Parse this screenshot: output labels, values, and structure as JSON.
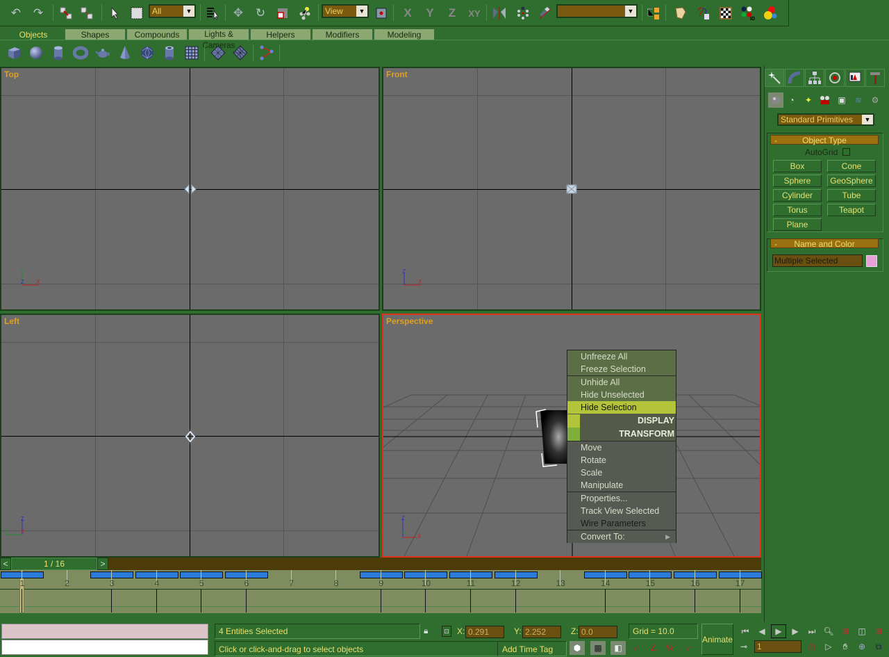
{
  "toolbar": {
    "selection_filter": "All",
    "reference_coord": "View",
    "named_selection": "",
    "constraint_labels": [
      "X",
      "Y",
      "Z",
      "XY"
    ]
  },
  "tabs": [
    {
      "label": "Objects",
      "active": true
    },
    {
      "label": "Shapes"
    },
    {
      "label": "Compounds"
    },
    {
      "label": "Lights & Cameras"
    },
    {
      "label": "Helpers"
    },
    {
      "label": "Modifiers"
    },
    {
      "label": "Modeling"
    }
  ],
  "object_icons": [
    "box-icon",
    "sphere-icon",
    "cylinder-icon",
    "torus-icon",
    "teapot-icon",
    "cone-icon",
    "geosphere-icon",
    "tube-icon",
    "plane-icon",
    "patch-quad-icon",
    "patch-tri-icon",
    "bone-icon"
  ],
  "viewports": {
    "top": {
      "label": "Top",
      "axes": [
        "Y",
        "Z",
        "X"
      ]
    },
    "front": {
      "label": "Front",
      "axes": [
        "Z",
        "X"
      ]
    },
    "left": {
      "label": "Left",
      "axes": [
        "Z",
        "Y",
        "X"
      ]
    },
    "perspective": {
      "label": "Perspective",
      "axes": [
        "Z",
        "Y",
        "X"
      ],
      "active": true
    }
  },
  "quad_menu": {
    "upper": [
      "Unfreeze All",
      "Freeze Selection",
      "Unhide All",
      "Hide Unselected",
      "Hide Selection"
    ],
    "highlighted": "Hide Selection",
    "display_title": "DISPLAY",
    "transform_title": "TRANSFORM",
    "lower": [
      "Move",
      "Rotate",
      "Scale",
      "Manipulate",
      "Properties...",
      "Track View Selected",
      "Wire Parameters",
      "Convert To:"
    ]
  },
  "command_panel": {
    "category": "Standard Primitives",
    "object_type_title": "Object Type",
    "autogrid_label": "AutoGrid",
    "autogrid_checked": false,
    "buttons": [
      "Box",
      "Cone",
      "Sphere",
      "GeoSphere",
      "Cylinder",
      "Tube",
      "Torus",
      "Teapot",
      "Plane"
    ],
    "name_color_title": "Name and Color",
    "name_value": "Multiple Selected",
    "object_color": "#e8a0d8",
    "rollout_collapse": "-"
  },
  "time_slider": {
    "label": "1 / 16",
    "prev": "<",
    "next": ">",
    "current_frame": 1,
    "total_frames": 16
  },
  "track_bar": {
    "ticks": [
      "1",
      "2",
      "3",
      "4",
      "5",
      "6",
      "7",
      "8",
      "9",
      "10",
      "11",
      "12",
      "13",
      "14",
      "15",
      "16",
      "17"
    ],
    "keyed_frames": [
      1,
      3,
      4,
      5,
      6,
      9,
      10,
      11,
      12,
      14,
      15,
      16,
      17
    ]
  },
  "status": {
    "selection": "4 Entities Selected",
    "prompt": "Click or click-and-drag to select objects",
    "x_label": "X:",
    "x_value": "0.291",
    "y_label": "Y:",
    "y_value": "2.252",
    "z_label": "Z:",
    "z_value": "0.0",
    "grid": "Grid = 10.0",
    "add_time_tag": "Add Time Tag",
    "animate": "Animate",
    "frame_value": "1"
  },
  "colors": {
    "ui_bg": "#2f6e2f",
    "viewport_bg": "#6b6b6b",
    "active_border": "#e0301c",
    "label": "#e0a020",
    "highlight": "#b4c43a"
  }
}
